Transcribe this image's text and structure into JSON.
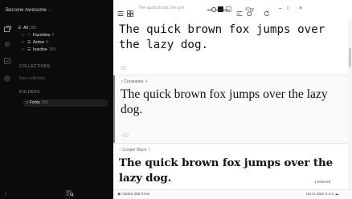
{
  "sidebar": {
    "app_title": "Become Awesome",
    "caret": "⌄",
    "nav": [
      {
        "label": "All",
        "count": "355"
      },
      {
        "label": "Favorites",
        "count": "0"
      },
      {
        "label": "Active",
        "count": "0"
      },
      {
        "label": "Inactive",
        "count": "355"
      }
    ],
    "collections_heading": "COLLECTIONS",
    "new_collection": "New collection",
    "folders_heading": "FOLDERS",
    "folders": [
      {
        "label": "Fonts",
        "count": "355"
      }
    ]
  },
  "toolbar": {
    "search_placeholder": "The quick brown fox jum",
    "size": "42px",
    "minimize": "–",
    "maximize": "□",
    "close": "×"
  },
  "fonts": [
    {
      "name": "",
      "count": "",
      "sample": "The quick brown fox jumps over the lazy dog."
    },
    {
      "name": "Constantia",
      "count": "4",
      "sample": "The quick brown fox jumps over the lazy dog."
    },
    {
      "name": "Cooper Black",
      "count": "1",
      "sample": "The quick brown fox jumps over the lazy dog."
    }
  ],
  "selection_label": "1 Selected",
  "status": {
    "left": "Added 355 fonts",
    "right": "Up to date 2.4.1"
  },
  "colors": {
    "sidebar_bg": "#0b0b0b",
    "accent": "#111111"
  }
}
